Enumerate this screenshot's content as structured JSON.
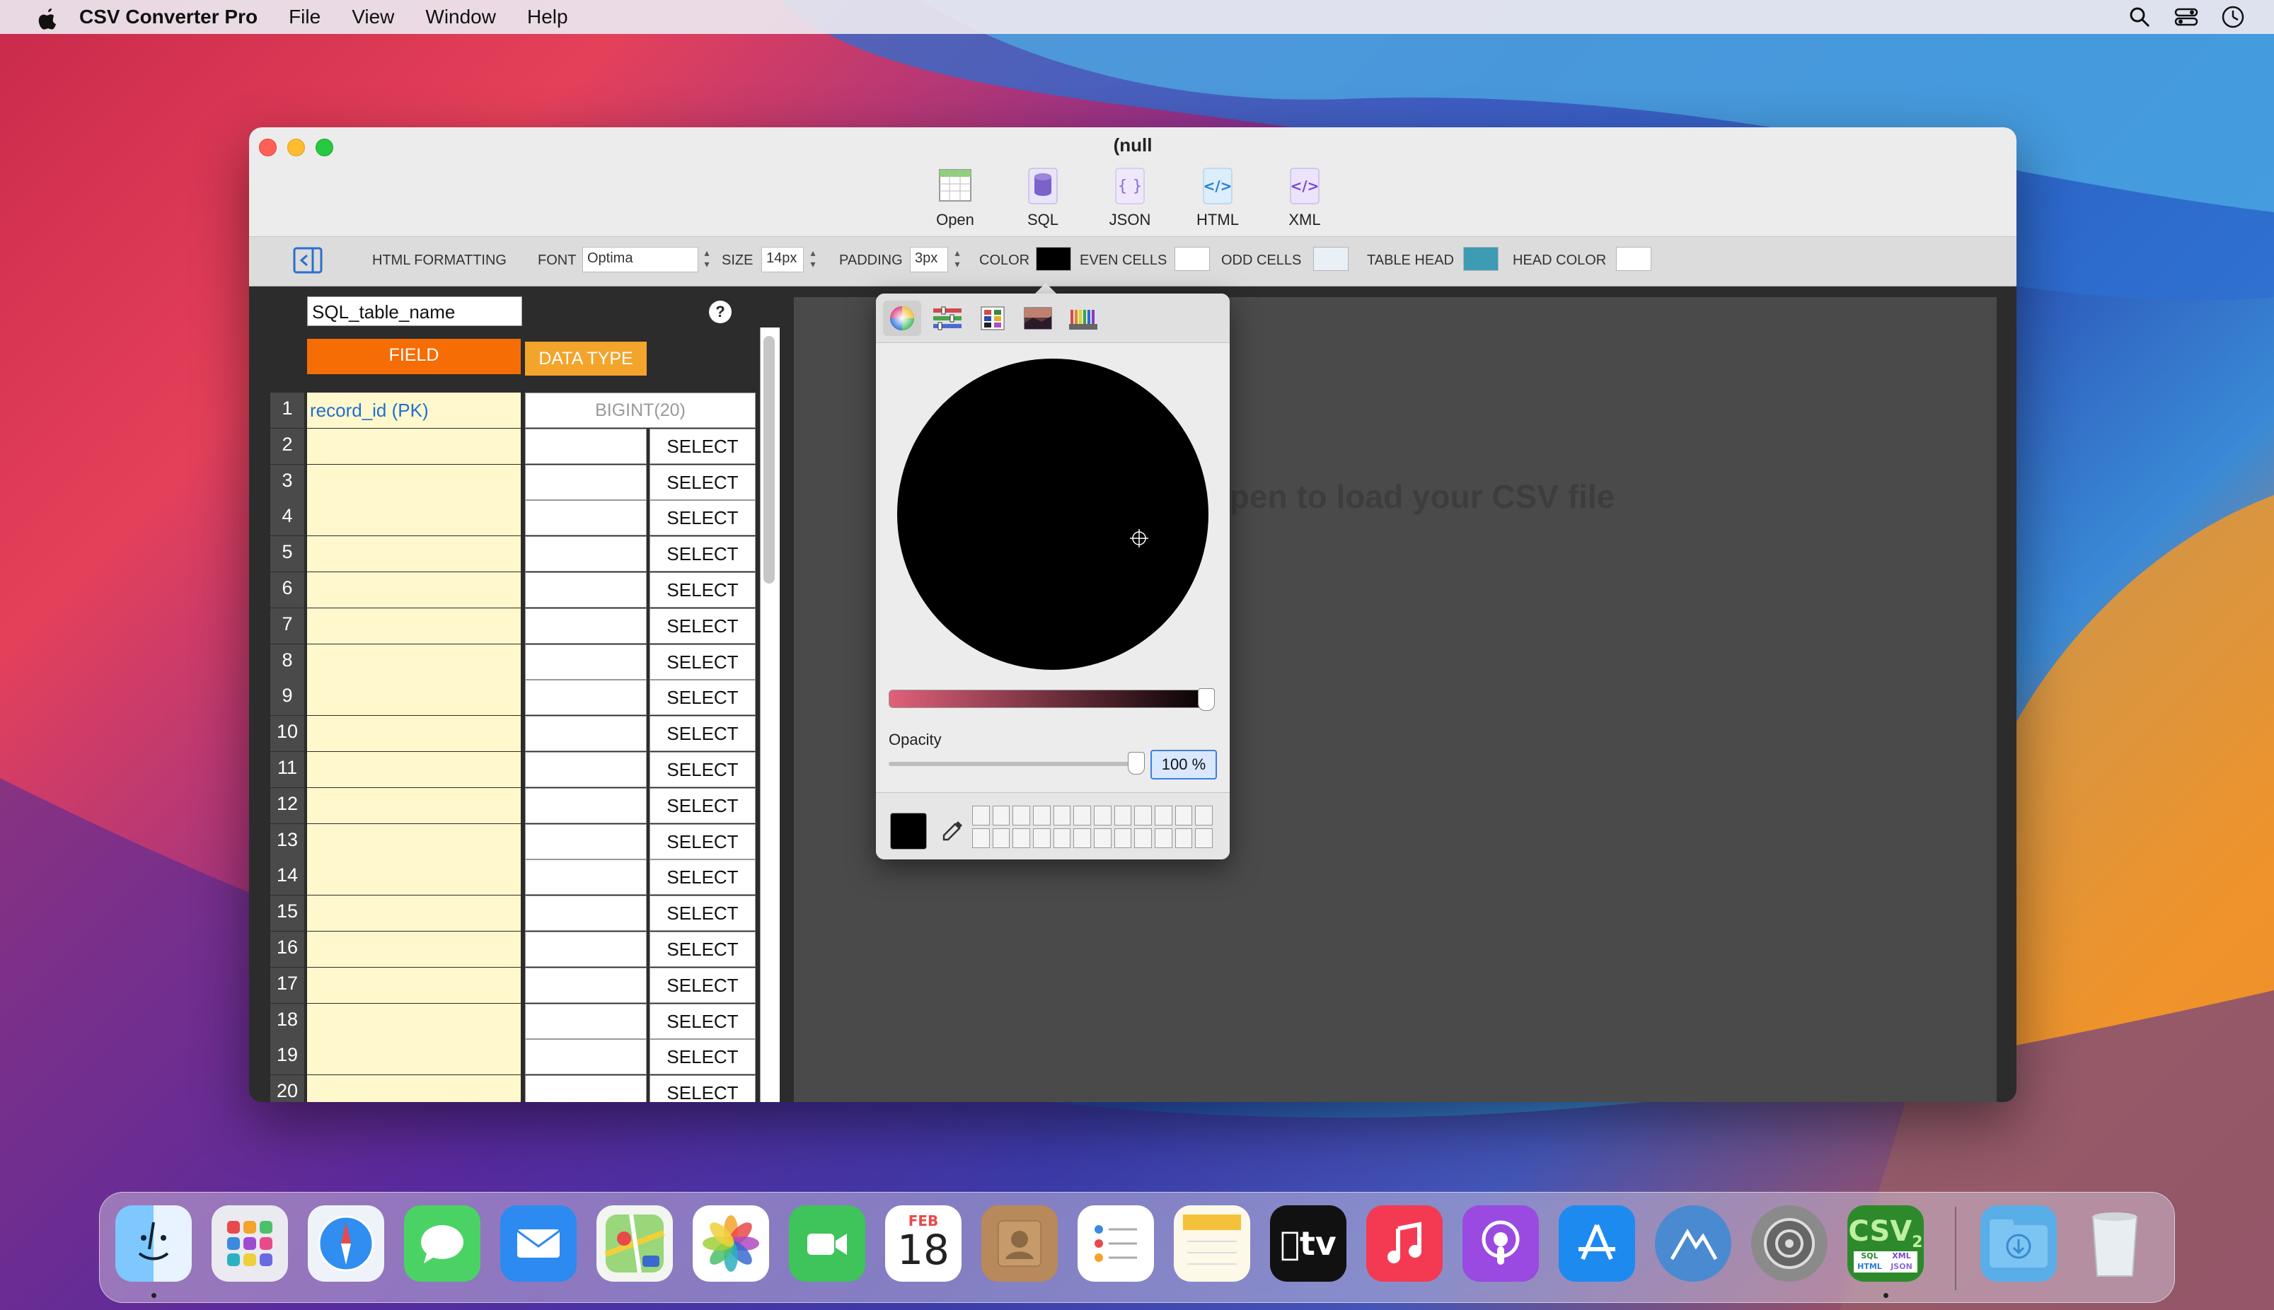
{
  "menubar": {
    "app_name": "CSV Converter Pro",
    "menus": [
      "File",
      "View",
      "Window",
      "Help"
    ]
  },
  "window": {
    "title": "(null",
    "toolbar": [
      {
        "label": "Open",
        "icon": "table-grid-icon"
      },
      {
        "label": "SQL",
        "icon": "database-icon"
      },
      {
        "label": "JSON",
        "icon": "json-braces-icon"
      },
      {
        "label": "HTML",
        "icon": "html-code-icon"
      },
      {
        "label": "XML",
        "icon": "xml-code-icon"
      }
    ]
  },
  "formatting": {
    "section_label": "HTML FORMATTING",
    "font_label": "FONT",
    "font_value": "Optima",
    "size_label": "SIZE",
    "size_value": "14px",
    "padding_label": "PADDING",
    "padding_value": "3px",
    "color_label": "COLOR",
    "color_value": "#000000",
    "even_cells_label": "EVEN CELLS",
    "even_cells_color": "#ffffff",
    "odd_cells_label": "ODD CELLS",
    "odd_cells_color": "#eaf1f6",
    "table_head_label": "TABLE HEAD",
    "table_head_color": "#3d9bb4",
    "head_color_label": "HEAD COLOR",
    "head_color_value": "#ffffff"
  },
  "schema": {
    "table_name": "SQL_table_name",
    "help": "?",
    "field_header": "FIELD",
    "type_header": "DATA TYPE",
    "rows": [
      {
        "num": "1",
        "field": "record_id (PK)",
        "type": "BIGINT(20)"
      },
      {
        "num": "2",
        "field": "",
        "select": "SELECT"
      },
      {
        "num": "3",
        "field": "",
        "select": "SELECT"
      },
      {
        "num": "4",
        "field": "",
        "select": "SELECT"
      },
      {
        "num": "5",
        "field": "",
        "select": "SELECT"
      },
      {
        "num": "6",
        "field": "",
        "select": "SELECT"
      },
      {
        "num": "7",
        "field": "",
        "select": "SELECT"
      },
      {
        "num": "8",
        "field": "",
        "select": "SELECT"
      },
      {
        "num": "9",
        "field": "",
        "select": "SELECT"
      },
      {
        "num": "10",
        "field": "",
        "select": "SELECT"
      },
      {
        "num": "11",
        "field": "",
        "select": "SELECT"
      },
      {
        "num": "12",
        "field": "",
        "select": "SELECT"
      },
      {
        "num": "13",
        "field": "",
        "select": "SELECT"
      },
      {
        "num": "14",
        "field": "",
        "select": "SELECT"
      },
      {
        "num": "15",
        "field": "",
        "select": "SELECT"
      },
      {
        "num": "16",
        "field": "",
        "select": "SELECT"
      },
      {
        "num": "17",
        "field": "",
        "select": "SELECT"
      },
      {
        "num": "18",
        "field": "",
        "select": "SELECT"
      },
      {
        "num": "19",
        "field": "",
        "select": "SELECT"
      },
      {
        "num": "20",
        "field": "",
        "select": "SELECT"
      }
    ]
  },
  "main": {
    "message": "Open to load your CSV file"
  },
  "color_picker": {
    "tabs": [
      "color-wheel-icon",
      "color-sliders-icon",
      "color-palettes-icon",
      "image-palettes-icon",
      "crayons-icon"
    ],
    "opacity_label": "Opacity",
    "opacity_value": "100 %",
    "current_color": "#000000"
  },
  "dock": {
    "apps": [
      "Finder",
      "Launchpad",
      "Safari",
      "Messages",
      "Mail",
      "Maps",
      "Photos",
      "FaceTime",
      "Calendar",
      "Contacts",
      "Reminders",
      "Notes",
      "TV",
      "Music",
      "Podcasts",
      "App Store",
      "Altimeter",
      "System Preferences",
      "CSV Converter Pro",
      "Downloads",
      "Trash"
    ],
    "calendar_month": "FEB",
    "calendar_day": "18",
    "tv_label": "tv",
    "csv_label": "CSV",
    "csv_sub": "2",
    "csv_formats": [
      "SQL",
      "XML",
      "HTML",
      "JSON"
    ]
  }
}
